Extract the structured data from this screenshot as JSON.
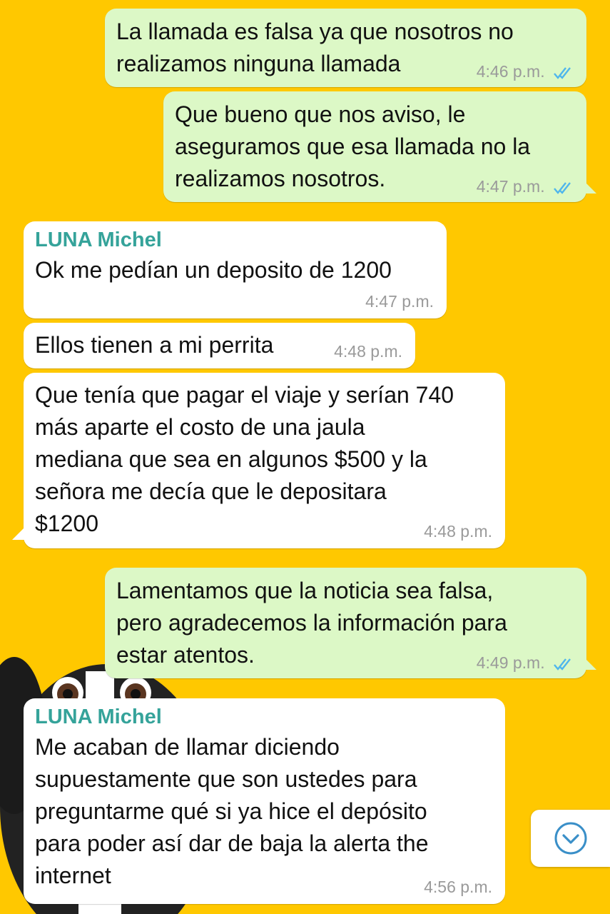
{
  "messages": [
    {
      "direction": "out",
      "text": "La llamada es falsa ya que nosotros no\nrealizamos ninguna llamada",
      "time": "4:46 p.m.",
      "status": "read"
    },
    {
      "direction": "out",
      "text": "Que bueno que nos aviso, le\naseguramos que esa llamada no la\nrealizamos nosotros.",
      "time": "4:47 p.m.",
      "status": "read"
    },
    {
      "direction": "in",
      "sender": "LUNA Michel",
      "text": "Ok me pedían un deposito de 1200",
      "time": "4:47 p.m."
    },
    {
      "direction": "in",
      "text": "Ellos tienen a mi perrita",
      "time": "4:48 p.m."
    },
    {
      "direction": "in",
      "text": "Que tenía que pagar el viaje y serían 740\nmás aparte el costo de una jaula\nmediana que sea en algunos $500 y la\nseñora me decía que le depositara\n$1200",
      "time": "4:48 p.m."
    },
    {
      "direction": "out",
      "text": "Lamentamos que la noticia sea falsa,\npero agradecemos la información para\nestar atentos.",
      "time": "4:49 p.m.",
      "status": "read"
    },
    {
      "direction": "in",
      "sender": "LUNA Michel",
      "text": "Me acaban de llamar diciendo\nsupuestamente que son ustedes para\npreguntarme qué si ya hice el depósito\npara poder así dar de baja la alerta the\ninternet",
      "time": "4:56 p.m."
    }
  ],
  "icons": {
    "read_receipt": "double-check-icon",
    "scroll_down": "chevron-down-icon"
  },
  "colors": {
    "background": "#FFC800",
    "outgoing_bubble": "#DCF8C6",
    "incoming_bubble": "#FFFFFF",
    "sender_name": "#35A39A",
    "read_ticks": "#4FB6EC",
    "timestamp": "#9A9A9A"
  }
}
